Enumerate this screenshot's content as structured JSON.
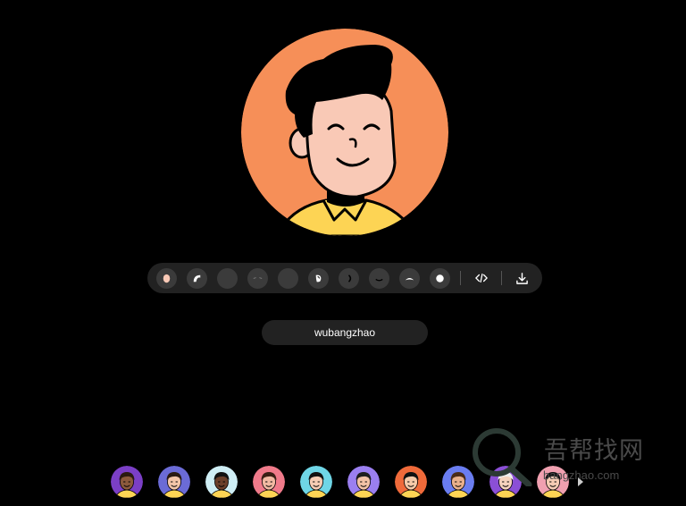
{
  "colors": {
    "avatar_bg": "#f68f58",
    "toolbar_bg": "#222222",
    "button_bg": "#3b3b3b",
    "accent_white": "#ffffff"
  },
  "main_avatar": {
    "background": "#f68f58",
    "skin": "#f9c9b6",
    "hair": "#000000",
    "shirt": "#fdd454"
  },
  "toolbar": {
    "items": [
      {
        "name": "face-option-button",
        "icon": "face-icon"
      },
      {
        "name": "hair-option-button",
        "icon": "hair-icon"
      },
      {
        "name": "hat-option-button",
        "icon": "empty-icon"
      },
      {
        "name": "eyebrows-option-button",
        "icon": "eyebrows-icon"
      },
      {
        "name": "glasses-option-button",
        "icon": "empty-icon"
      },
      {
        "name": "ear-option-button",
        "icon": "ear-icon"
      },
      {
        "name": "earring-option-button",
        "icon": "earring-icon"
      },
      {
        "name": "mouth-option-button",
        "icon": "mouth-icon"
      },
      {
        "name": "beard-option-button",
        "icon": "beard-icon"
      },
      {
        "name": "shirt-option-button",
        "icon": "dot-icon"
      }
    ],
    "code_action": "code-icon",
    "download_action": "download-icon"
  },
  "name_input": {
    "value": "wubangzhao"
  },
  "gallery": {
    "thumbs": [
      {
        "bg": "#7b3fc6",
        "skin": "#8c5a3c",
        "hair": "#2b1a10"
      },
      {
        "bg": "#6b6bd6",
        "skin": "#f3c5a8",
        "hair": "#2a1a12"
      },
      {
        "bg": "#cfeef5",
        "skin": "#6b3f2a",
        "hair": "#111111"
      },
      {
        "bg": "#f07a8a",
        "skin": "#f1b9a2",
        "hair": "#3a1f14"
      },
      {
        "bg": "#6fd6e6",
        "skin": "#f5ccb4",
        "hair": "#111111"
      },
      {
        "bg": "#9b7ff0",
        "skin": "#f2c2a6",
        "hair": "#1e1e1e"
      },
      {
        "bg": "#f06a3a",
        "skin": "#f6caa9",
        "hair": "#111111"
      },
      {
        "bg": "#6a7df0",
        "skin": "#e9b08c",
        "hair": "#4a2b18"
      },
      {
        "bg": "#8b4fd6",
        "skin": "#f5d2bd",
        "hair": "#eeeeee"
      },
      {
        "bg": "#f0a0b0",
        "skin": "#f6ccb4",
        "hair": "#111111"
      }
    ]
  },
  "watermark": {
    "title": "吾帮找网",
    "url": "bangzhao.com"
  }
}
